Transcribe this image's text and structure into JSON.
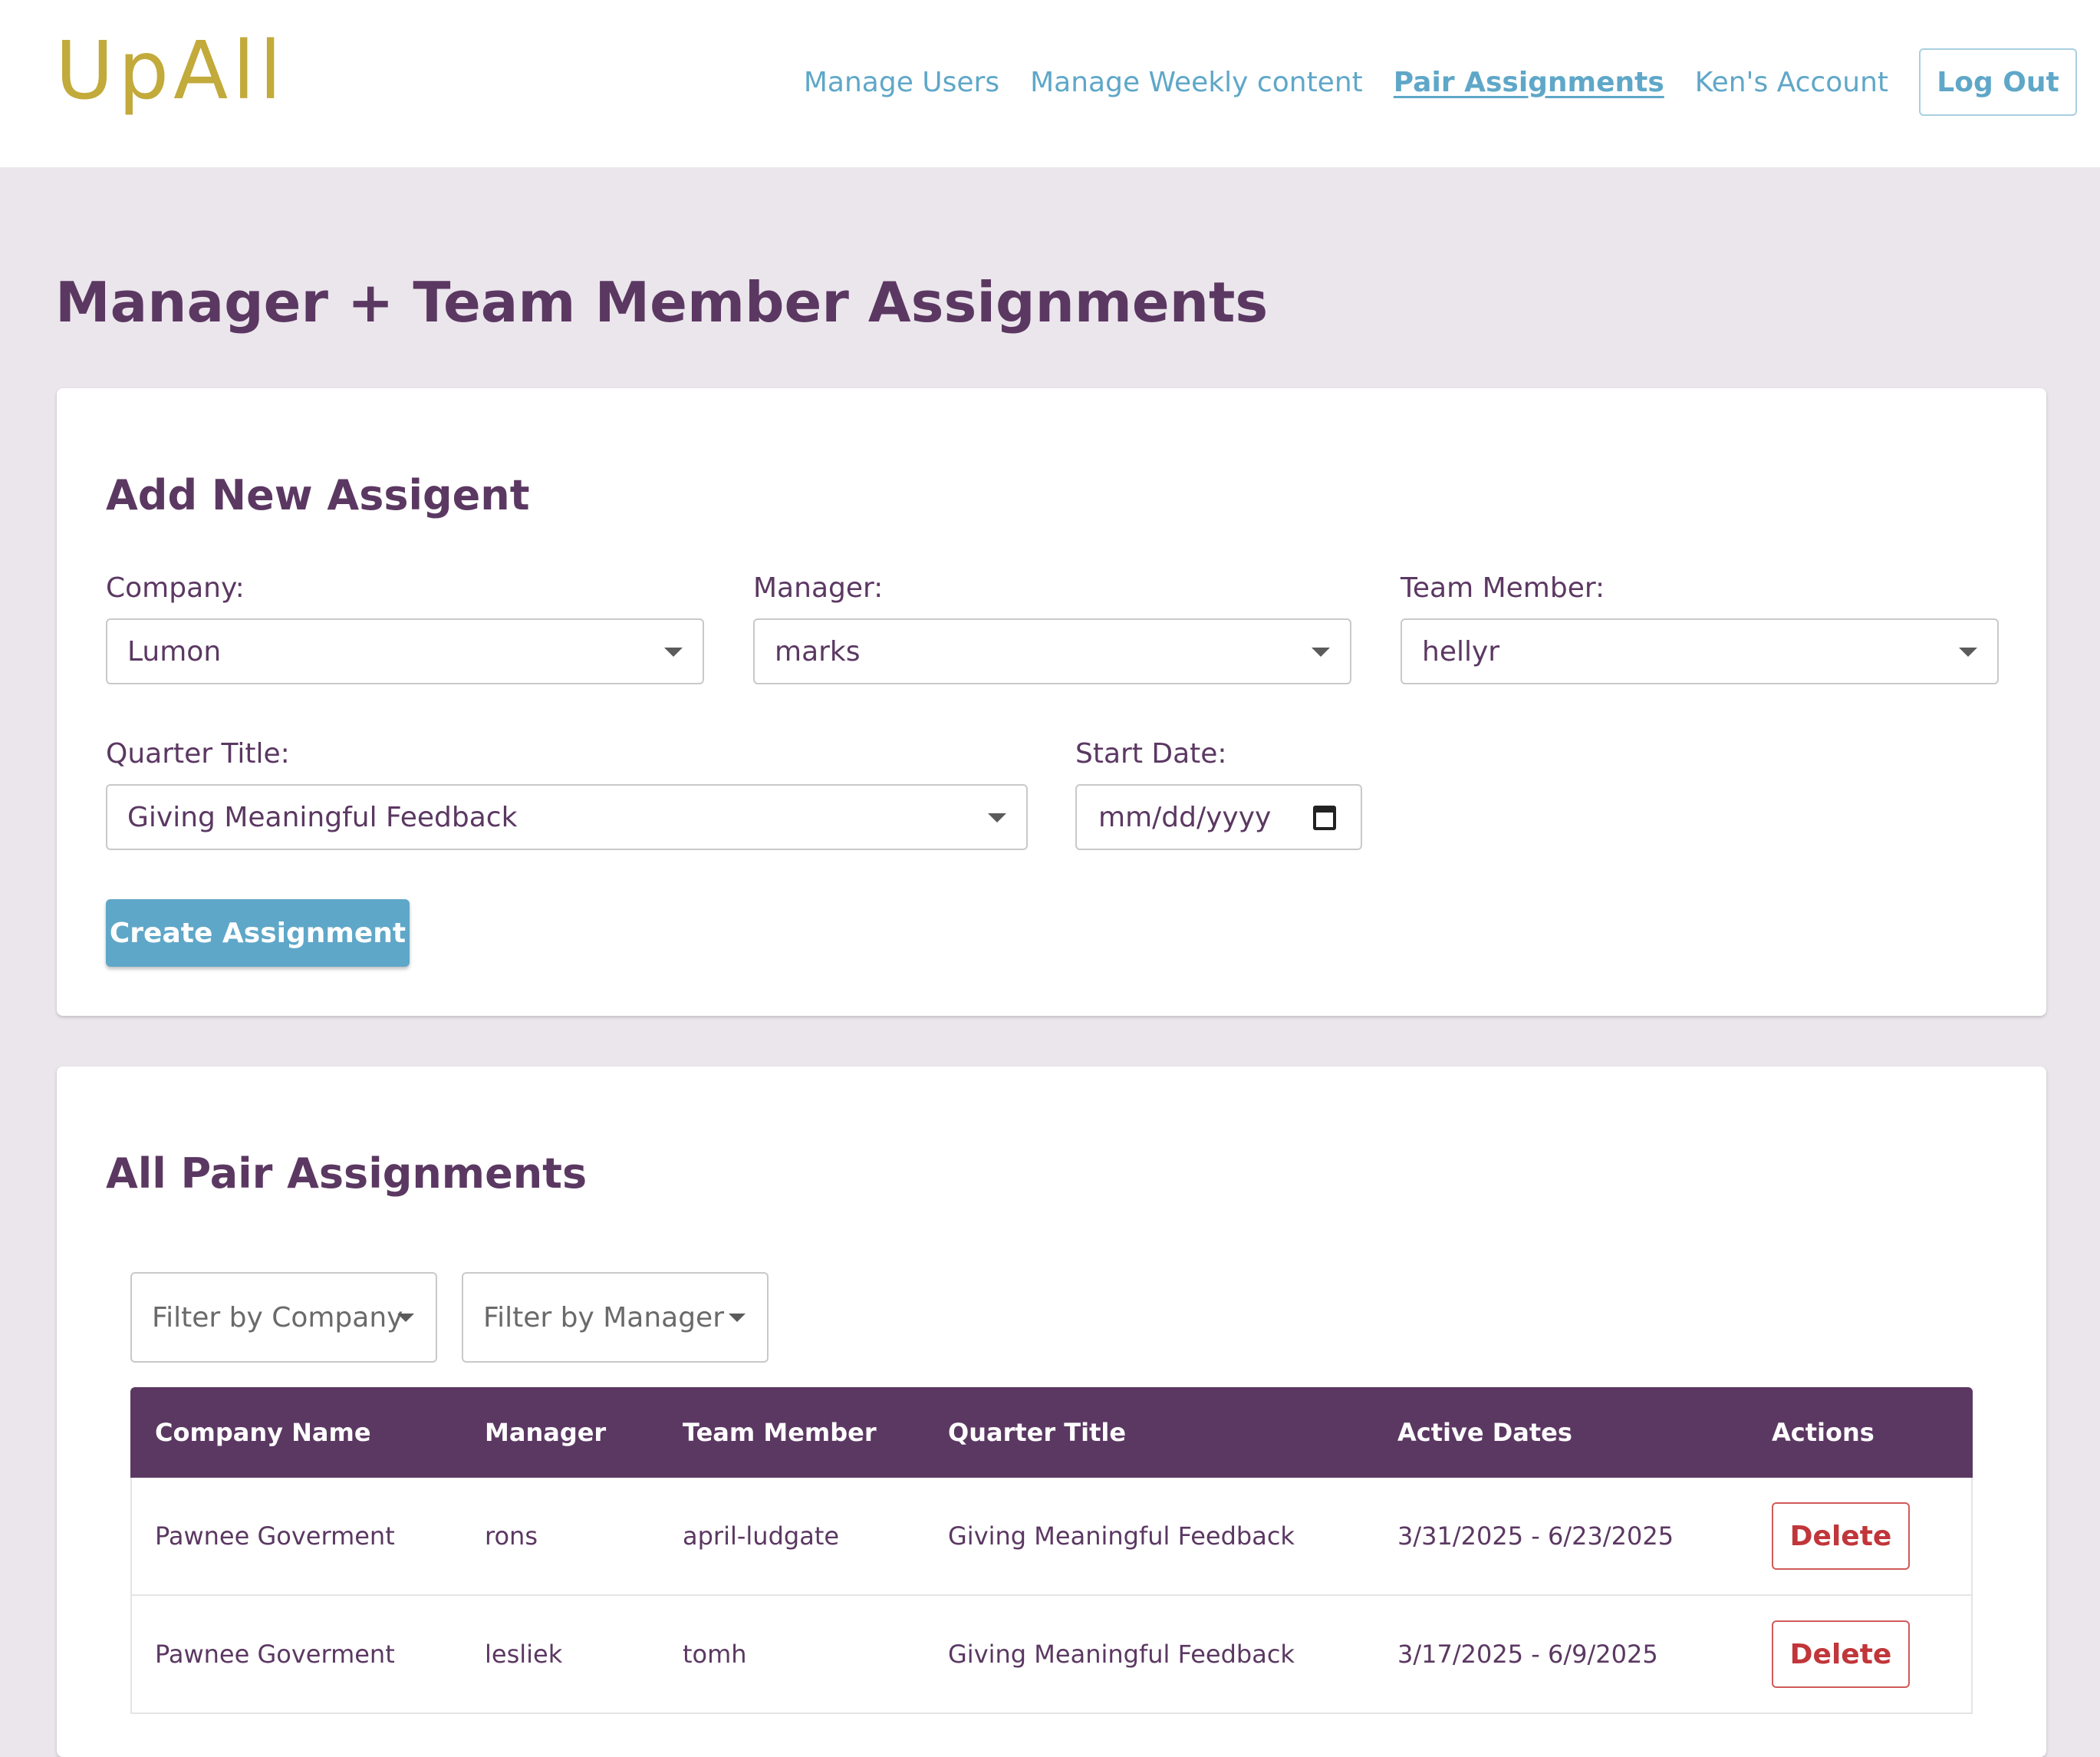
{
  "brand": {
    "logo_text": "UpAll",
    "logo_color": "#c2aa3b"
  },
  "nav": {
    "items": [
      {
        "label": "Manage Users",
        "active": false
      },
      {
        "label": "Manage Weekly content",
        "active": false
      },
      {
        "label": "Pair Assignments",
        "active": true
      },
      {
        "label": "Ken's Account",
        "active": false
      }
    ],
    "logout_label": "Log Out",
    "link_color": "#5fa7c8"
  },
  "page": {
    "title": "Manager + Team Member Assignments"
  },
  "add_form": {
    "title": "Add New Assigent",
    "company": {
      "label": "Company:",
      "value": "Lumon"
    },
    "manager": {
      "label": "Manager:",
      "value": "marks"
    },
    "team_member": {
      "label": "Team Member:",
      "value": "hellyr"
    },
    "quarter_title": {
      "label": "Quarter Title:",
      "value": "Giving Meaningful Feedback"
    },
    "start_date": {
      "label": "Start Date:",
      "placeholder": "mm/dd/yyyy",
      "value": ""
    },
    "submit_label": "Create Assignment"
  },
  "assignments": {
    "title": "All Pair Assignments",
    "filter_company": "Filter by Company",
    "filter_manager": "Filter by Manager",
    "header_color": "#5b3862",
    "columns": [
      "Company Name",
      "Manager",
      "Team Member",
      "Quarter Title",
      "Active Dates",
      "Actions"
    ],
    "rows": [
      {
        "company": "Pawnee Goverment",
        "manager": "rons",
        "team_member": "april-ludgate",
        "quarter_title": "Giving Meaningful Feedback",
        "active_dates": "3/31/2025 - 6/23/2025",
        "action_label": "Delete"
      },
      {
        "company": "Pawnee Goverment",
        "manager": "lesliek",
        "team_member": "tomh",
        "quarter_title": "Giving Meaningful Feedback",
        "active_dates": "3/17/2025 - 6/9/2025",
        "action_label": "Delete"
      }
    ]
  }
}
